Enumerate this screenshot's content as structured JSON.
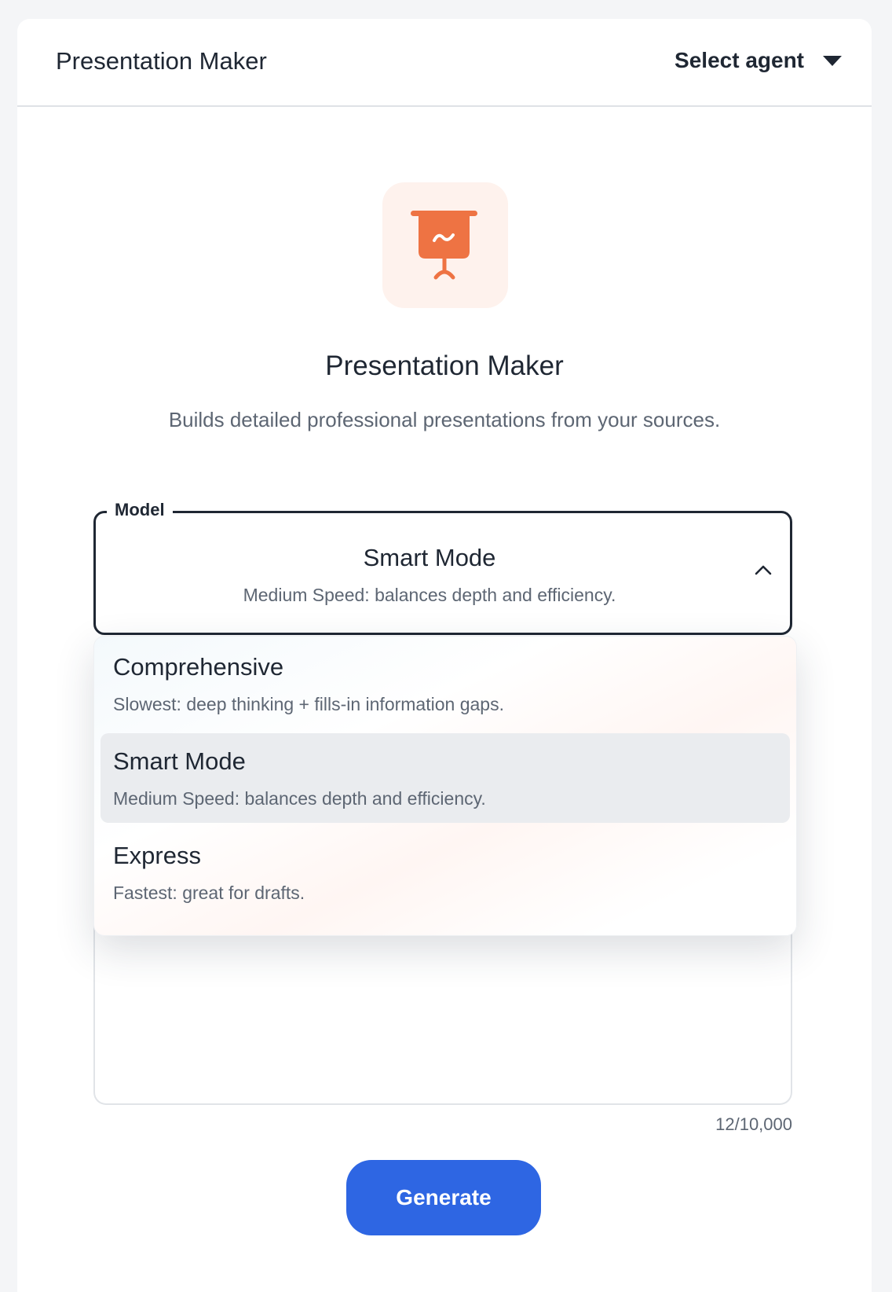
{
  "header": {
    "title": "Presentation Maker",
    "agent_select_label": "Select agent"
  },
  "agent": {
    "icon": "presentation-board-icon",
    "title": "Presentation Maker",
    "description": "Builds detailed professional presentations from your sources."
  },
  "model_select": {
    "label": "Model",
    "selected_title": "Smart Mode",
    "selected_description": "Medium Speed: balances depth and efficiency.",
    "expanded": true,
    "options": [
      {
        "title": "Comprehensive",
        "description": "Slowest: deep thinking + fills-in information gaps."
      },
      {
        "title": "Smart Mode",
        "description": "Medium Speed: balances depth and efficiency.",
        "selected": true
      },
      {
        "title": "Express",
        "description": "Fastest: great for drafts."
      }
    ]
  },
  "prompt": {
    "char_count": "12/10,000"
  },
  "actions": {
    "generate_label": "Generate"
  },
  "colors": {
    "accent": "#2e66e3",
    "icon_orange": "#ee7343",
    "icon_tile": "#fef2ed",
    "selected_option_bg": "#eaecef",
    "text_primary": "#1f2733",
    "text_secondary": "#5d6673"
  }
}
